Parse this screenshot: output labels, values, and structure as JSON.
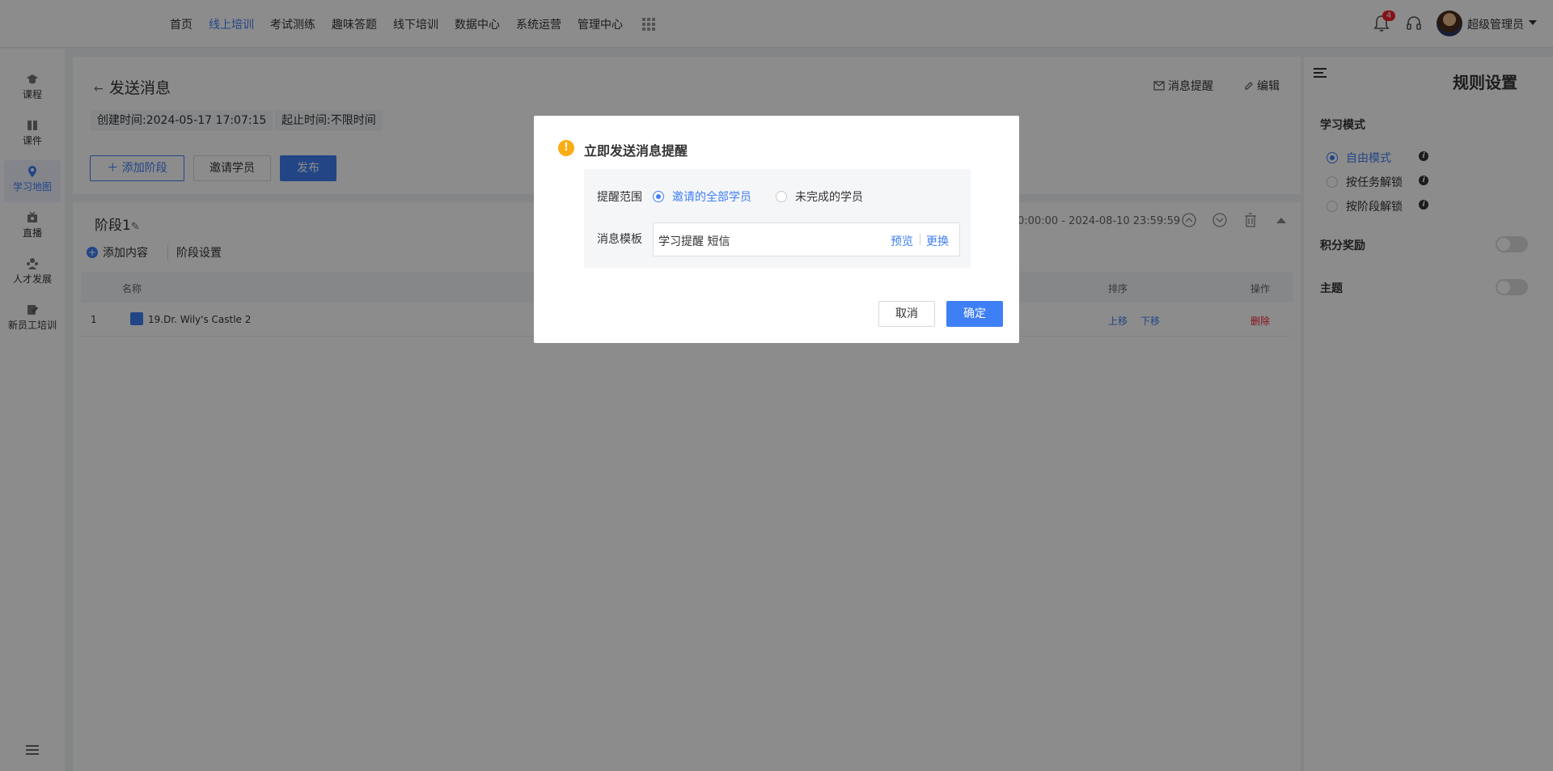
{
  "nav": {
    "items": [
      "首页",
      "线上培训",
      "考试测练",
      "趣味答题",
      "线下培训",
      "数据中心",
      "系统运营",
      "管理中心"
    ],
    "active": "线上培训",
    "notification_count": "4",
    "user_name": "超级管理员"
  },
  "sidebar": {
    "items": [
      {
        "label": "课程",
        "icon": "graduation-cap-icon"
      },
      {
        "label": "课件",
        "icon": "book-icon"
      },
      {
        "label": "学习地图",
        "icon": "map-pin-icon"
      },
      {
        "label": "直播",
        "icon": "live-icon"
      },
      {
        "label": "人才发展",
        "icon": "people-icon"
      },
      {
        "label": "新员工培训",
        "icon": "edit-icon"
      }
    ],
    "active": "学习地图"
  },
  "header": {
    "title": "发送消息",
    "message_reminder": "消息提醒",
    "edit": "编辑",
    "created_label": "创建时间:",
    "created_value": "2024-05-17 17:07:15",
    "period_label": "起止时间:",
    "period_value": "不限时间",
    "add_stage": "添加阶段",
    "invite": "邀请学员",
    "publish": "发布"
  },
  "stage": {
    "title": "阶段1",
    "range": "0:00:00 - 2024-08-10 23:59:59",
    "add_content": "添加内容",
    "settings": "阶段设置",
    "columns": {
      "name": "名称",
      "sort": "排序",
      "action": "操作"
    },
    "rows": [
      {
        "index": "1",
        "name": "19.Dr. Wily's Castle 2",
        "up": "上移",
        "down": "下移",
        "delete": "删除"
      }
    ]
  },
  "rules": {
    "title": "规则设置",
    "mode_label": "学习模式",
    "modes": [
      "自由模式",
      "按任务解锁",
      "按阶段解锁"
    ],
    "active_mode": "自由模式",
    "points_label": "积分奖励",
    "points_on": false,
    "theme_label": "主题",
    "theme_on": false
  },
  "modal": {
    "title": "立即发送消息提醒",
    "scope_label": "提醒范围",
    "scope_options": [
      "邀请的全部学员",
      "未完成的学员"
    ],
    "scope_selected": "邀请的全部学员",
    "template_label": "消息模板",
    "template_value": "学习提醒 短信",
    "preview": "预览",
    "change": "更换",
    "cancel": "取消",
    "confirm": "确定"
  },
  "colors": {
    "accent": "#3f7ff5",
    "warning": "#faad14",
    "danger": "#f5222d"
  }
}
